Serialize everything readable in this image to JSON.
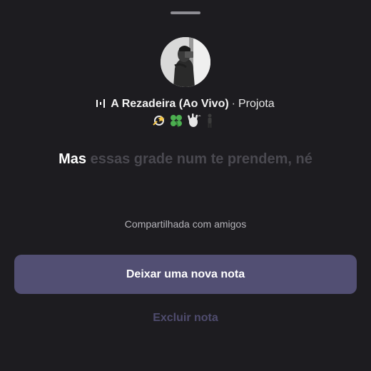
{
  "note": {
    "song": {
      "title": "A Rezadeira (Ao Vivo)",
      "separator": "·",
      "artist": "Projota",
      "icon": "music-equalizer-icon"
    },
    "emojis": [
      "dizzy-emoji",
      "four-leaf-clover-emoji",
      "waving-hand-emoji",
      "person-standing-emoji"
    ],
    "lyrics": {
      "active": "Mas",
      "rest": "essas grade num te prendem, né"
    },
    "shared_label": "Compartilhada com amigos"
  },
  "actions": {
    "new_note_label": "Deixar uma nova nota",
    "delete_note_label": "Excluir nota"
  },
  "colors": {
    "background": "#1d1c20",
    "primary_button": "#524f73",
    "delete_text": "#4f4c6e",
    "lyrics_inactive": "#4a4950"
  }
}
